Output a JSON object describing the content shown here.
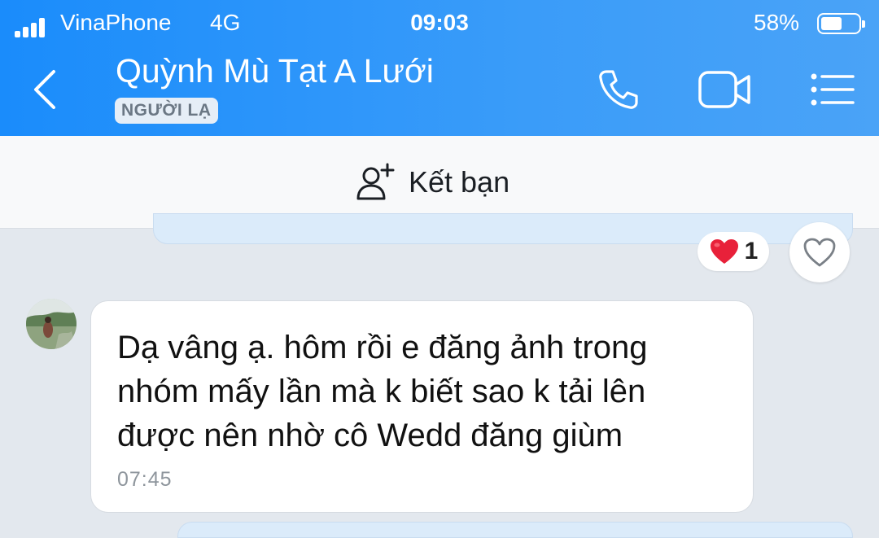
{
  "status_bar": {
    "carrier": "VinaPhone",
    "network": "4G",
    "time": "09:03",
    "battery_percent": "58%",
    "battery_level": 0.58
  },
  "header": {
    "contact_name": "Quỳnh Mù Tạt A Lưới",
    "badge": "NGƯỜI LẠ",
    "icons": [
      "back-chevron-icon",
      "phone-icon",
      "video-camera-icon",
      "menu-list-icon"
    ]
  },
  "friend_bar": {
    "label": "Kết bạn",
    "icon": "add-friend-icon"
  },
  "previous_message": {
    "reaction_icon": "heart-icon",
    "reaction_count": "1"
  },
  "messages": [
    {
      "lines": [
        "Dạ vâng ạ. hôm rồi e đăng ảnh trong",
        "nhóm mấy lần mà k biết sao k tải lên",
        "được nên nhờ cô Wedd đăng giùm"
      ],
      "time": "07:45"
    }
  ],
  "colors": {
    "header_blue": "#1a8cfb",
    "chat_background": "#e3e8ee",
    "heart_red": "#e8213a"
  }
}
